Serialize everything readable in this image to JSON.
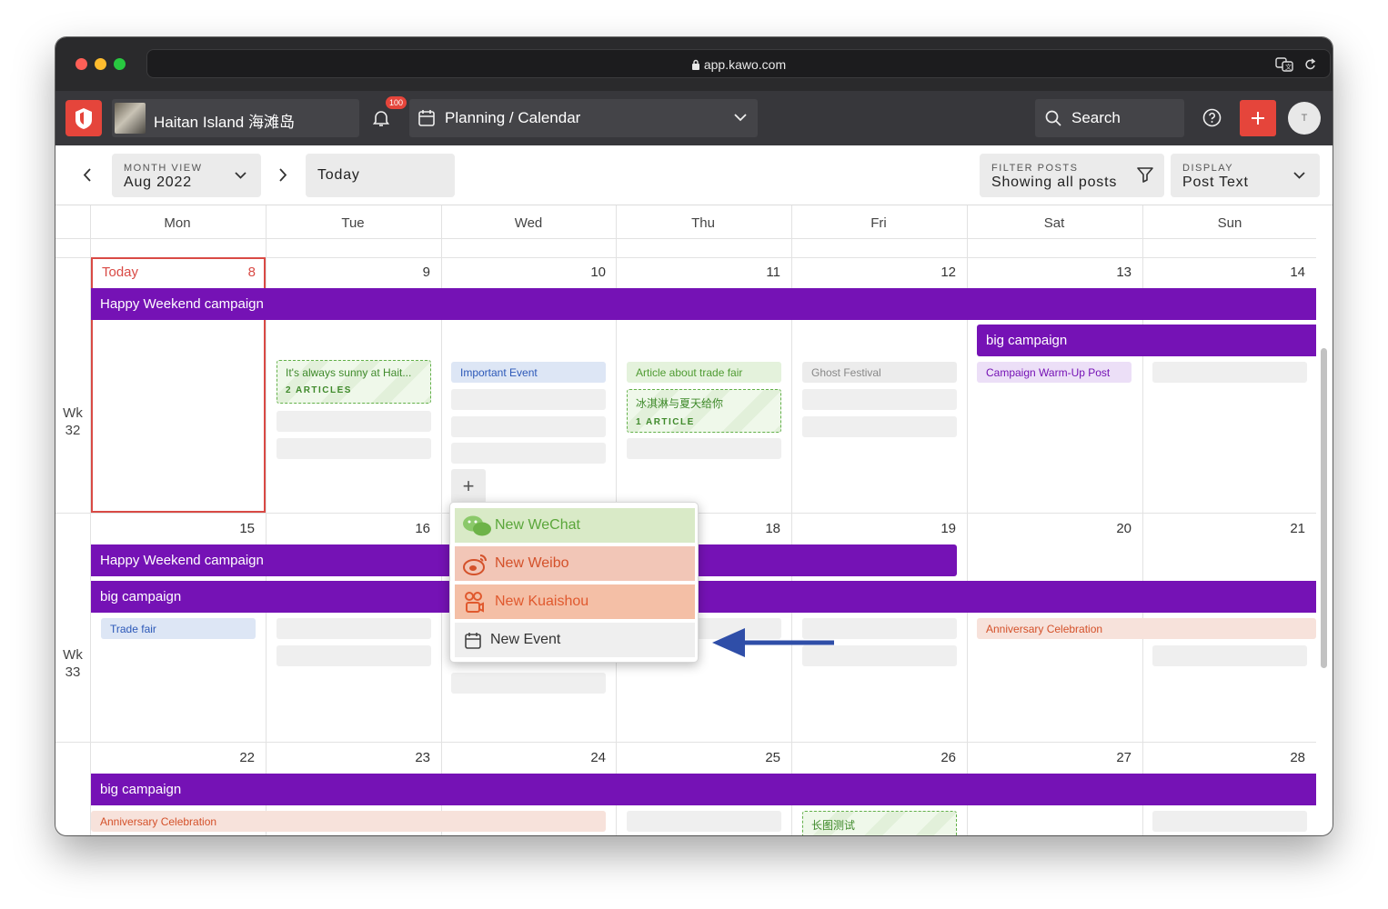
{
  "browser": {
    "url": "app.kawo.com"
  },
  "appbar": {
    "brand_name": "Haitan Island 海滩岛",
    "notification_count": "100",
    "section": "Planning / Calendar",
    "search_label": "Search",
    "avatar_initial": "T"
  },
  "toolbar": {
    "view_label": "MONTH VIEW",
    "view_value": "Aug 2022",
    "today_label": "Today",
    "filter_label": "FILTER POSTS",
    "filter_value": "Showing all posts",
    "display_label": "DISPLAY",
    "display_value": "Post Text"
  },
  "calendar": {
    "days": [
      "Mon",
      "Tue",
      "Wed",
      "Thu",
      "Fri",
      "Sat",
      "Sun"
    ],
    "weeks": [
      {
        "label": [
          "Wk",
          "32"
        ],
        "dates": [
          "8",
          "9",
          "10",
          "11",
          "12",
          "13",
          "14"
        ]
      },
      {
        "label": [
          "Wk",
          "33"
        ],
        "dates": [
          "15",
          "16",
          "",
          "18",
          "19",
          "20",
          "21"
        ]
      },
      {
        "dates": [
          "22",
          "23",
          "24",
          "25",
          "26",
          "27",
          "28"
        ]
      }
    ],
    "today_label": "Today",
    "week1": {
      "campaign_happy": "Happy Weekend campaign",
      "campaign_big": "big campaign",
      "tue_article_title": "It's always sunny at Hait...",
      "tue_article_count": "2 ARTICLES",
      "wed_event": "Important Event",
      "thu_post": "Article about trade fair",
      "thu_article_title": "冰淇淋与夏天给你",
      "thu_article_count": "1 ARTICLE",
      "fri_post": "Ghost Festival",
      "sat_post": "Campaign Warm-Up Post",
      "add_label": "+"
    },
    "week2": {
      "campaign_happy": "Happy Weekend campaign",
      "campaign_big": "big campaign",
      "mon_event": "Trade fair",
      "sat_event": "Anniversary Celebration"
    },
    "week3": {
      "campaign_big": "big campaign",
      "mon_event": "Anniversary Celebration",
      "fri_article": "长图测试"
    }
  },
  "menu": {
    "items": [
      {
        "label": "New WeChat",
        "icon": "wechat-icon",
        "color": "#d9eac7",
        "text_color": "#5aa63a"
      },
      {
        "label": "New Weibo",
        "icon": "weibo-icon",
        "color": "#f2c6b7",
        "text_color": "#d4512a"
      },
      {
        "label": "New Kuaishou",
        "icon": "kuaishou-icon",
        "color": "#f4bfa6",
        "text_color": "#e0592e"
      },
      {
        "label": "New Event",
        "icon": "calendar-icon",
        "color": "#efefef",
        "text_color": "#333333"
      }
    ]
  },
  "colors": {
    "campaign": "#7512b5",
    "brand": "#e5453b",
    "today": "#d94a45",
    "arrow": "#2f4ea8"
  }
}
